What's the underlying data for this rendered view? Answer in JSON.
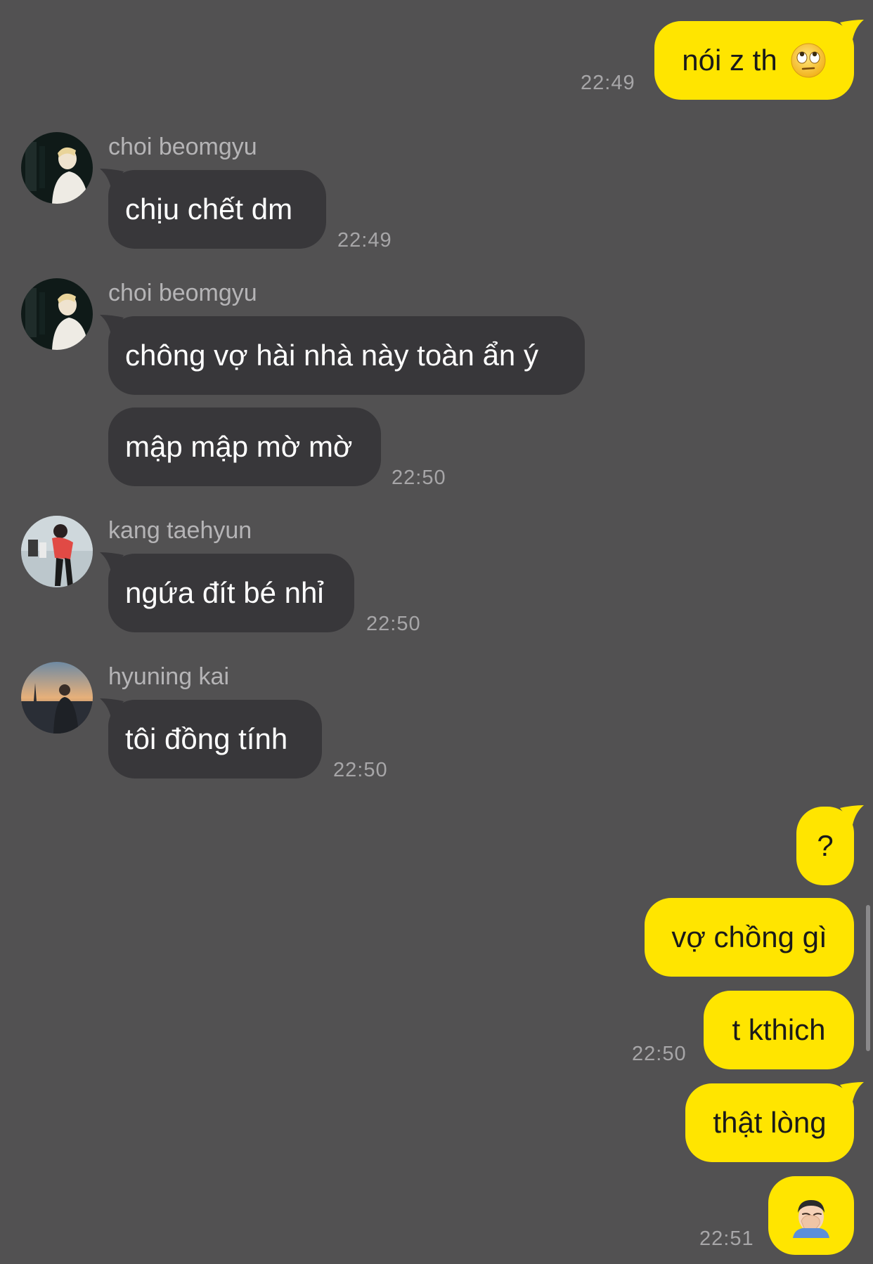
{
  "messages": [
    {
      "from": "me",
      "text": "nói z th",
      "emoji": "face-with-rolling-eyes-icon",
      "time": "22:49"
    },
    {
      "from": "choi beomgyu",
      "text": "chịu chết dm",
      "time": "22:49"
    },
    {
      "from": "choi beomgyu",
      "text": "chông vợ hài nhà này toàn ẩn ý"
    },
    {
      "from": "choi beomgyu",
      "text": "mập mập mờ mờ",
      "time": "22:50"
    },
    {
      "from": "kang taehyun",
      "text": "ngứa đít bé nhỉ",
      "time": "22:50"
    },
    {
      "from": "hyuning kai",
      "text": "tôi đồng tính",
      "time": "22:50"
    },
    {
      "from": "me",
      "text": "?"
    },
    {
      "from": "me",
      "text": "vợ chồng gì"
    },
    {
      "from": "me",
      "text": "t kthich",
      "time": "22:50"
    },
    {
      "from": "me",
      "text": "thật lòng"
    },
    {
      "from": "me",
      "emoji": "man-facepalming-icon",
      "time": "22:51"
    }
  ],
  "senders": {
    "beomgyu": "choi beomgyu",
    "taehyun": "kang taehyun",
    "kai": "hyuning kai"
  },
  "colors": {
    "background": "#525152",
    "incoming_bubble": "#38373a",
    "outgoing_bubble": "#ffe500",
    "timestamp": "#a7a6a8"
  }
}
